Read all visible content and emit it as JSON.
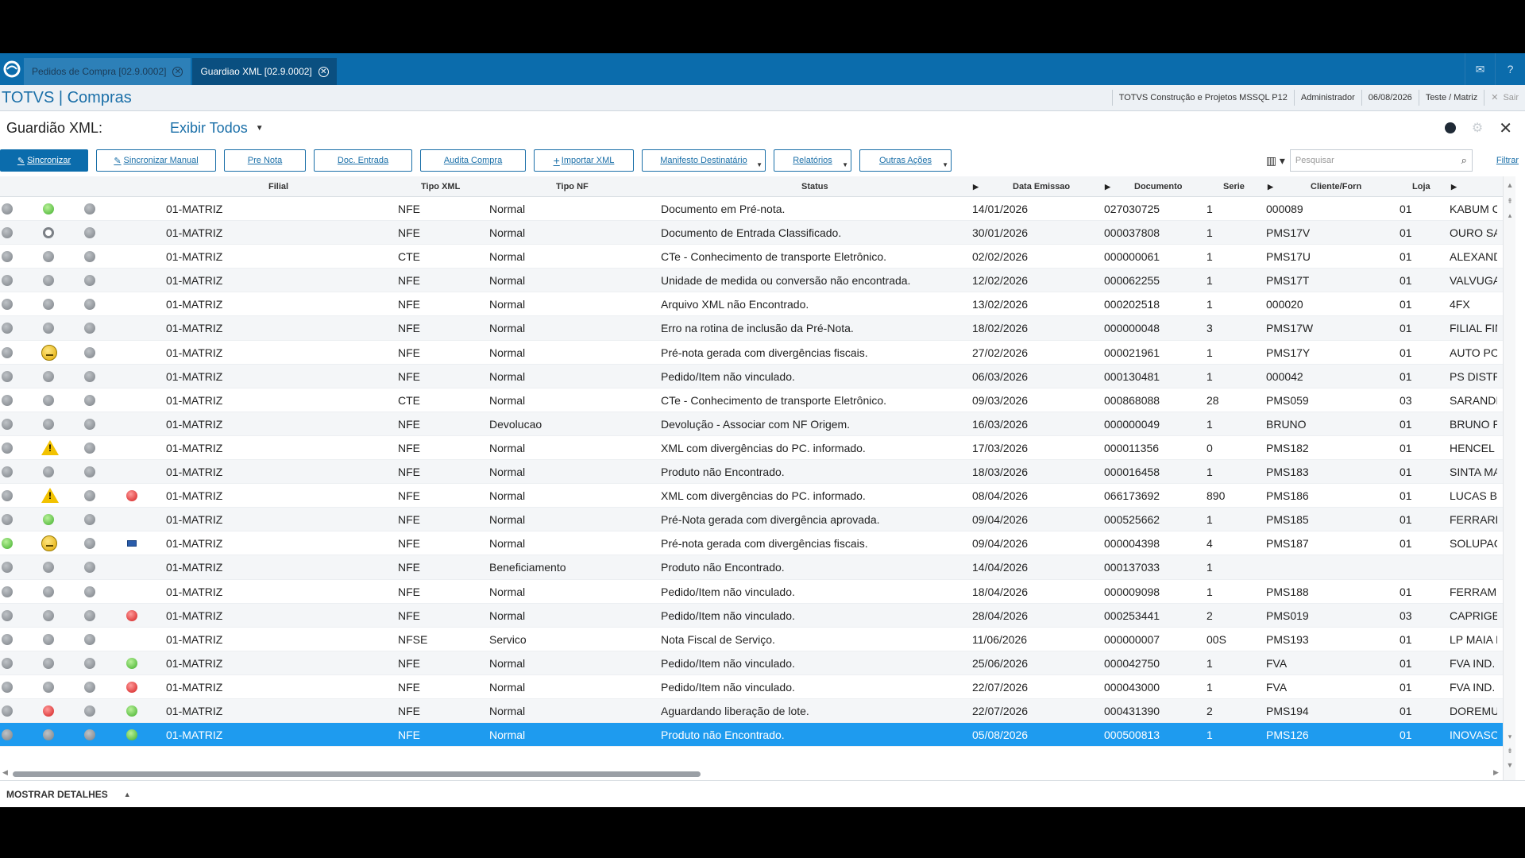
{
  "tabs": [
    {
      "label": "Pedidos de Compra [02.9.0002]",
      "active": false
    },
    {
      "label": "Guardiao XML [02.9.0002]",
      "active": true
    }
  ],
  "header": {
    "brand": "TOTVS | Compras",
    "company": "TOTVS Construção e Projetos MSSQL P12",
    "user": "Administrador",
    "date": "06/08/2026",
    "branch": "Teste / Matriz",
    "logout": "Sair"
  },
  "page": {
    "title": "Guardião XML:",
    "filter": "Exibir Todos"
  },
  "toolbar": {
    "sync": "Sincronizar",
    "sync_manual": "Sincronizar Manual",
    "pre_nota": "Pre Nota",
    "doc_entrada": "Doc. Entrada",
    "audita": "Audita Compra",
    "importar": "Importar XML",
    "manifesto": "Manifesto Destinatário",
    "relatorios": "Relatórios",
    "outras": "Outras Ações",
    "search_placeholder": "Pesquisar",
    "filtrar": "Filtrar"
  },
  "columns": {
    "filial": "Filial",
    "tipo_xml": "Tipo XML",
    "tipo_nf": "Tipo NF",
    "status": "Status",
    "data": "Data Emissao",
    "documento": "Documento",
    "serie": "Serie",
    "cliente": "Cliente/Forn",
    "loja": "Loja"
  },
  "rows": [
    {
      "i1": "grey",
      "i2": "green",
      "i3": "grey",
      "i4": "",
      "filial": "01-MATRIZ",
      "tipo_xml": "NFE",
      "tipo_nf": "Normal",
      "status": "Documento em Pré-nota.",
      "data": "14/01/2026",
      "doc": "027030725",
      "serie": "1",
      "cliente": "000089",
      "loja": "01",
      "nome": "KABUM C"
    },
    {
      "i1": "grey",
      "i2": "ring",
      "i3": "grey",
      "i4": "",
      "filial": "01-MATRIZ",
      "tipo_xml": "NFE",
      "tipo_nf": "Normal",
      "status": "Documento de Entrada Classificado.",
      "data": "30/01/2026",
      "doc": "000037808",
      "serie": "1",
      "cliente": "PMS17V",
      "loja": "01",
      "nome": "OURO SA"
    },
    {
      "i1": "grey",
      "i2": "grey",
      "i3": "grey",
      "i4": "",
      "filial": "01-MATRIZ",
      "tipo_xml": "CTE",
      "tipo_nf": "Normal",
      "status": "CTe - Conhecimento de transporte Eletrônico.",
      "data": "02/02/2026",
      "doc": "000000061",
      "serie": "1",
      "cliente": "PMS17U",
      "loja": "01",
      "nome": "ALEXAND"
    },
    {
      "i1": "grey",
      "i2": "grey",
      "i3": "grey",
      "i4": "",
      "filial": "01-MATRIZ",
      "tipo_xml": "NFE",
      "tipo_nf": "Normal",
      "status": "Unidade de medida ou conversão não encontrada.",
      "data": "12/02/2026",
      "doc": "000062255",
      "serie": "1",
      "cliente": "PMS17T",
      "loja": "01",
      "nome": "VALVUGA"
    },
    {
      "i1": "grey",
      "i2": "grey",
      "i3": "grey",
      "i4": "",
      "filial": "01-MATRIZ",
      "tipo_xml": "NFE",
      "tipo_nf": "Normal",
      "status": "Arquivo XML não Encontrado.",
      "data": "13/02/2026",
      "doc": "000202518",
      "serie": "1",
      "cliente": "000020",
      "loja": "01",
      "nome": "4FX"
    },
    {
      "i1": "grey",
      "i2": "grey",
      "i3": "grey",
      "i4": "",
      "filial": "01-MATRIZ",
      "tipo_xml": "NFE",
      "tipo_nf": "Normal",
      "status": "Erro na rotina de inclusão da Pré-Nota.",
      "data": "18/02/2026",
      "doc": "000000048",
      "serie": "3",
      "cliente": "PMS17W",
      "loja": "01",
      "nome": "FILIAL FIN"
    },
    {
      "i1": "grey",
      "i2": "smile",
      "i3": "grey",
      "i4": "",
      "filial": "01-MATRIZ",
      "tipo_xml": "NFE",
      "tipo_nf": "Normal",
      "status": "Pré-nota gerada com divergências fiscais.",
      "data": "27/02/2026",
      "doc": "000021961",
      "serie": "1",
      "cliente": "PMS17Y",
      "loja": "01",
      "nome": "AUTO PO"
    },
    {
      "i1": "grey",
      "i2": "grey",
      "i3": "grey",
      "i4": "",
      "filial": "01-MATRIZ",
      "tipo_xml": "NFE",
      "tipo_nf": "Normal",
      "status": "Pedido/Item não vinculado.",
      "data": "06/03/2026",
      "doc": "000130481",
      "serie": "1",
      "cliente": "000042",
      "loja": "01",
      "nome": "PS DISTR"
    },
    {
      "i1": "grey",
      "i2": "grey",
      "i3": "grey",
      "i4": "",
      "filial": "01-MATRIZ",
      "tipo_xml": "CTE",
      "tipo_nf": "Normal",
      "status": "CTe - Conhecimento de transporte Eletrônico.",
      "data": "09/03/2026",
      "doc": "000868088",
      "serie": "28",
      "cliente": "PMS059",
      "loja": "03",
      "nome": "SARANDI"
    },
    {
      "i1": "grey",
      "i2": "grey",
      "i3": "grey",
      "i4": "",
      "filial": "01-MATRIZ",
      "tipo_xml": "NFE",
      "tipo_nf": "Devolucao",
      "status": "Devolução - Associar com NF Origem.",
      "data": "16/03/2026",
      "doc": "000000049",
      "serie": "1",
      "cliente": "BRUNO",
      "loja": "01",
      "nome": "BRUNO R"
    },
    {
      "i1": "grey",
      "i2": "warn",
      "i3": "grey",
      "i4": "",
      "filial": "01-MATRIZ",
      "tipo_xml": "NFE",
      "tipo_nf": "Normal",
      "status": "XML com divergências do PC. informado.",
      "data": "17/03/2026",
      "doc": "000011356",
      "serie": "0",
      "cliente": "PMS182",
      "loja": "01",
      "nome": "HENCEL I"
    },
    {
      "i1": "grey",
      "i2": "grey",
      "i3": "grey",
      "i4": "",
      "filial": "01-MATRIZ",
      "tipo_xml": "NFE",
      "tipo_nf": "Normal",
      "status": "Produto não Encontrado.",
      "data": "18/03/2026",
      "doc": "000016458",
      "serie": "1",
      "cliente": "PMS183",
      "loja": "01",
      "nome": "SINTA MA"
    },
    {
      "i1": "grey",
      "i2": "warn",
      "i3": "grey",
      "i4": "red",
      "filial": "01-MATRIZ",
      "tipo_xml": "NFE",
      "tipo_nf": "Normal",
      "status": "XML com divergências do PC. informado.",
      "data": "08/04/2026",
      "doc": "066173692",
      "serie": "890",
      "cliente": "PMS186",
      "loja": "01",
      "nome": "LUCAS BC"
    },
    {
      "i1": "grey",
      "i2": "green",
      "i3": "grey",
      "i4": "",
      "filial": "01-MATRIZ",
      "tipo_xml": "NFE",
      "tipo_nf": "Normal",
      "status": "Pré-Nota gerada com divergência aprovada.",
      "data": "09/04/2026",
      "doc": "000525662",
      "serie": "1",
      "cliente": "PMS185",
      "loja": "01",
      "nome": "FERRARI"
    },
    {
      "i1": "green",
      "i2": "smile",
      "i3": "grey",
      "i4": "blue",
      "filial": "01-MATRIZ",
      "tipo_xml": "NFE",
      "tipo_nf": "Normal",
      "status": "Pré-nota gerada com divergências fiscais.",
      "data": "09/04/2026",
      "doc": "000004398",
      "serie": "4",
      "cliente": "PMS187",
      "loja": "01",
      "nome": "SOLUPAC"
    },
    {
      "i1": "grey",
      "i2": "grey",
      "i3": "grey",
      "i4": "",
      "filial": "01-MATRIZ",
      "tipo_xml": "NFE",
      "tipo_nf": "Beneficiamento",
      "status": "Produto não Encontrado.",
      "data": "14/04/2026",
      "doc": "000137033",
      "serie": "1",
      "cliente": "",
      "loja": "",
      "nome": ""
    },
    {
      "i1": "grey",
      "i2": "grey",
      "i3": "grey",
      "i4": "",
      "filial": "01-MATRIZ",
      "tipo_xml": "NFE",
      "tipo_nf": "Normal",
      "status": "Pedido/Item não vinculado.",
      "data": "18/04/2026",
      "doc": "000009098",
      "serie": "1",
      "cliente": "PMS188",
      "loja": "01",
      "nome": "FERRAME"
    },
    {
      "i1": "grey",
      "i2": "grey",
      "i3": "grey",
      "i4": "red",
      "filial": "01-MATRIZ",
      "tipo_xml": "NFE",
      "tipo_nf": "Normal",
      "status": "Pedido/Item não vinculado.",
      "data": "28/04/2026",
      "doc": "000253441",
      "serie": "2",
      "cliente": "PMS019",
      "loja": "03",
      "nome": "CAPRIGE"
    },
    {
      "i1": "grey",
      "i2": "grey",
      "i3": "grey",
      "i4": "",
      "filial": "01-MATRIZ",
      "tipo_xml": "NFSE",
      "tipo_nf": "Servico",
      "status": "Nota Fiscal de Serviço.",
      "data": "11/06/2026",
      "doc": "000000007",
      "serie": "00S",
      "cliente": "PMS193",
      "loja": "01",
      "nome": "LP MAIA F"
    },
    {
      "i1": "grey",
      "i2": "grey",
      "i3": "grey",
      "i4": "green",
      "filial": "01-MATRIZ",
      "tipo_xml": "NFE",
      "tipo_nf": "Normal",
      "status": "Pedido/Item não vinculado.",
      "data": "25/06/2026",
      "doc": "000042750",
      "serie": "1",
      "cliente": "FVA",
      "loja": "01",
      "nome": "FVA IND. Y"
    },
    {
      "i1": "grey",
      "i2": "grey",
      "i3": "grey",
      "i4": "red",
      "filial": "01-MATRIZ",
      "tipo_xml": "NFE",
      "tipo_nf": "Normal",
      "status": "Pedido/Item não vinculado.",
      "data": "22/07/2026",
      "doc": "000043000",
      "serie": "1",
      "cliente": "FVA",
      "loja": "01",
      "nome": "FVA IND. Y"
    },
    {
      "i1": "grey",
      "i2": "red",
      "i3": "grey",
      "i4": "green",
      "filial": "01-MATRIZ",
      "tipo_xml": "NFE",
      "tipo_nf": "Normal",
      "status": "Aguardando liberação de lote.",
      "data": "22/07/2026",
      "doc": "000431390",
      "serie": "2",
      "cliente": "PMS194",
      "loja": "01",
      "nome": "DOREMU"
    },
    {
      "i1": "grey",
      "i2": "grey",
      "i3": "grey",
      "i4": "green",
      "filial": "01-MATRIZ",
      "tipo_xml": "NFE",
      "tipo_nf": "Normal",
      "status": "Produto não Encontrado.",
      "data": "05/08/2026",
      "doc": "000500813",
      "serie": "1",
      "cliente": "PMS126",
      "loja": "01",
      "nome": "INOVASO",
      "selected": true
    }
  ],
  "footer": {
    "details": "MOSTRAR DETALHES"
  },
  "colors": {
    "primary": "#0b6cac",
    "selected_row": "#1e9bef",
    "brand": "#1a6fa8"
  }
}
